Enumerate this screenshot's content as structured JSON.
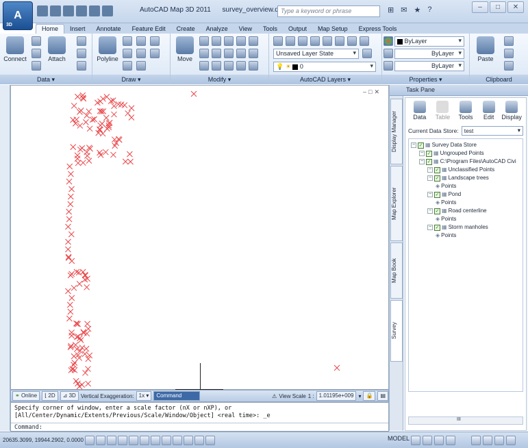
{
  "titlebar": {
    "app_name": "AutoCAD Map 3D 2011",
    "file_name": "survey_overview.dwg",
    "search_placeholder": "Type a keyword or phrase",
    "app_button_badge": "3D"
  },
  "ribbon_tabs": [
    "Home",
    "Insert",
    "Annotate",
    "Feature Edit",
    "Create",
    "Analyze",
    "View",
    "Tools",
    "Output",
    "Map Setup",
    "Express Tools"
  ],
  "active_tab": "Home",
  "panels": {
    "data": {
      "title": "Data ▾",
      "connect": "Connect",
      "attach": "Attach"
    },
    "draw": {
      "title": "Draw ▾",
      "polyline": "Polyline"
    },
    "modify": {
      "title": "Modify ▾",
      "move": "Move"
    },
    "layers": {
      "title": "AutoCAD Layers ▾",
      "layer_state": "Unsaved Layer State",
      "current_layer": "0"
    },
    "properties": {
      "title": "Properties ▾",
      "color": "ByLayer",
      "linetype": "ByLayer",
      "lineweight": "ByLayer"
    },
    "clipboard": {
      "title": "Clipboard",
      "paste": "Paste"
    }
  },
  "viewport_bar": {
    "online": "Online",
    "mode_2d": "2D",
    "mode_3d": "3D",
    "vert_exag_label": "Vertical Exaggeration:",
    "vert_exag_value": "1x",
    "command_tab": "Command",
    "view_scale_label": "View Scale",
    "view_scale_ratio": "1 :",
    "view_scale_value": "1.01195e+009"
  },
  "command_window": {
    "history_1": "Specify corner of window, enter a scale factor (nX or nXP), or",
    "history_2": "[All/Center/Dynamic/Extents/Previous/Scale/Window/Object] <real time>: _e",
    "prompt": "Command:"
  },
  "statusbar": {
    "coordinates": "20635.3099, 19944.2902, 0.0000",
    "model": "MODEL"
  },
  "taskpane": {
    "title": "Task Pane",
    "vtabs": [
      "Display Manager",
      "Map Explorer",
      "Map Book",
      "Survey"
    ],
    "active_vtab": "Survey",
    "tools": [
      "Data",
      "Table",
      "Tools",
      "Edit",
      "Display"
    ],
    "store_label": "Current Data Store:",
    "store_value": "test",
    "tree": [
      {
        "label": "Survey Data Store",
        "level": 0
      },
      {
        "label": "Ungrouped Points",
        "level": 1
      },
      {
        "label": "C:\\Program Files\\AutoCAD Civi",
        "level": 1
      },
      {
        "label": "Unclassified Points",
        "level": 2
      },
      {
        "label": "Landscape trees",
        "level": 2
      },
      {
        "label": "Points",
        "level": 3
      },
      {
        "label": "Pond",
        "level": 2
      },
      {
        "label": "Points",
        "level": 3
      },
      {
        "label": "Road centerline",
        "level": 2
      },
      {
        "label": "Points",
        "level": 3
      },
      {
        "label": "Storm manholes",
        "level": 2
      },
      {
        "label": "Points",
        "level": 3
      }
    ],
    "scroll_label": "III"
  },
  "colors": {
    "survey_point": "#e8474a",
    "ribbon_blue": "#c5d6ec",
    "command_tab": "#3d6aa6"
  }
}
